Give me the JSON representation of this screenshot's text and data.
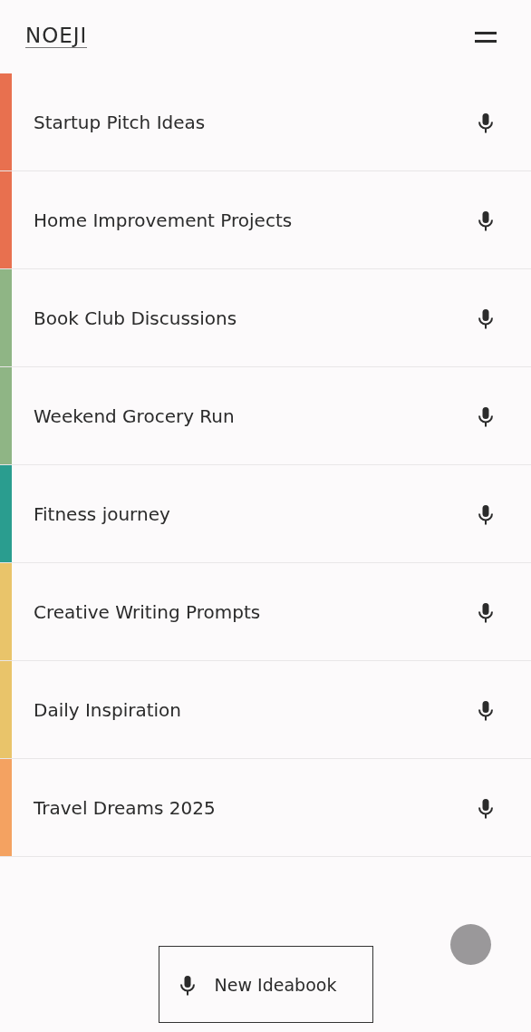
{
  "app": {
    "logo": "NOEJI"
  },
  "ideabooks": [
    {
      "title": "Startup Pitch Ideas",
      "color": "#e8704f"
    },
    {
      "title": "Home Improvement Projects",
      "color": "#e8704f"
    },
    {
      "title": "Book Club Discussions",
      "color": "#8fb585"
    },
    {
      "title": "Weekend Grocery Run",
      "color": "#8fb585"
    },
    {
      "title": "Fitness journey",
      "color": "#2a9d8f"
    },
    {
      "title": "Creative Writing Prompts",
      "color": "#e9c46a"
    },
    {
      "title": "Daily Inspiration",
      "color": "#e9c46a"
    },
    {
      "title": "Travel Dreams 2025",
      "color": "#f4a261"
    }
  ],
  "new_button": {
    "label": "New Ideabook"
  }
}
